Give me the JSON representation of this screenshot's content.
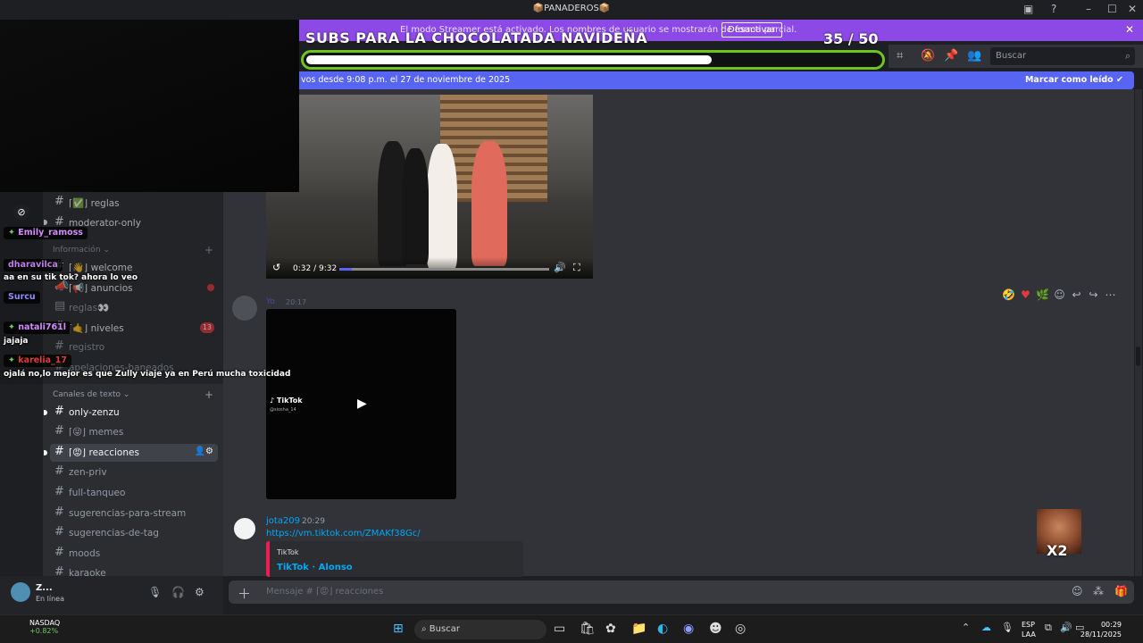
{
  "window": {
    "title": "📦PANADEROS📦"
  },
  "streamer_banner": {
    "text": "El modo Streamer está activado. Los nombres de usuario se mostrarán de forma parcial.",
    "button": "Desactivar"
  },
  "goal_overlay": {
    "title": "SUBS PARA LA CHOCOLATADA NAVIDEÑA",
    "current": 35,
    "target": 50,
    "count_text": "35  / 50",
    "progress_fraction": 0.7
  },
  "toolbar": {
    "search_placeholder": "Buscar"
  },
  "new_messages_bar": {
    "text": "vos desde 9:08 p.m. el 27 de noviembre de 2025",
    "mark_read": "Marcar como leído"
  },
  "video_embed": {
    "time": "0:32 / 9:32",
    "progress_fraction": 0.06
  },
  "messages": [
    {
      "author": "Yo",
      "time": "20:17",
      "embed_label": "TikTok",
      "embed_handle": "@siosha_14"
    },
    {
      "author": "jota209",
      "time": "20:29",
      "link": "https://vm.tiktok.com/ZMAKf38Gc/",
      "embed_provider": "TikTok",
      "embed_title": "TikTok · Alonso"
    }
  ],
  "emote_overlay": {
    "multiplier": "X2"
  },
  "composer": {
    "placeholder": "Mensaje #  ⌈😡⌋ reacciones"
  },
  "sidebar": {
    "categories": {
      "info": "Información",
      "text": "Canales de texto"
    },
    "channels": [
      {
        "name": "⌈✅⌋ reglas"
      },
      {
        "name": "moderator-only"
      },
      {
        "name": "⌈👋⌋ welcome"
      },
      {
        "name": "⌈📢⌋ anuncios"
      },
      {
        "name": "reglas👀"
      },
      {
        "name": "⌈🤙⌋ niveles",
        "badge": "13"
      },
      {
        "name": "registro"
      },
      {
        "name": "apelaciones-baneados"
      },
      {
        "name": "only-zenzu"
      },
      {
        "name": "⌈😜⌋ memes"
      },
      {
        "name": "⌈😡⌋ reacciones"
      },
      {
        "name": "zen-priv"
      },
      {
        "name": "full-tanqueo"
      },
      {
        "name": "sugerencias-para-stream"
      },
      {
        "name": "sugerencias-de-tag"
      },
      {
        "name": "moods"
      },
      {
        "name": "karaoke"
      }
    ]
  },
  "stream_chat": [
    {
      "user": "Emily_ramoss",
      "color": "#d48cff"
    },
    {
      "user": "dharavilca",
      "color": "#c07be8",
      "message": "aa en su tik tok? ahora lo veo"
    },
    {
      "user": "Surcu",
      "color": "#8f8cff"
    },
    {
      "user": "natali761l",
      "color": "#d48cff",
      "message": "jajaja"
    },
    {
      "user": "karelia_17",
      "color": "#e23a3a",
      "message": "ojalá no,lo mejor es que Zully viaje ya en Perú mucha toxicidad"
    }
  ],
  "user_panel": {
    "name": "Z...",
    "status": "En línea"
  },
  "taskbar": {
    "stock_name": "NASDAQ",
    "stock_change": "+0.82%",
    "search": "Buscar",
    "lang_1": "ESP",
    "lang_2": "LAA",
    "time": "00:29",
    "date": "28/11/2025"
  }
}
